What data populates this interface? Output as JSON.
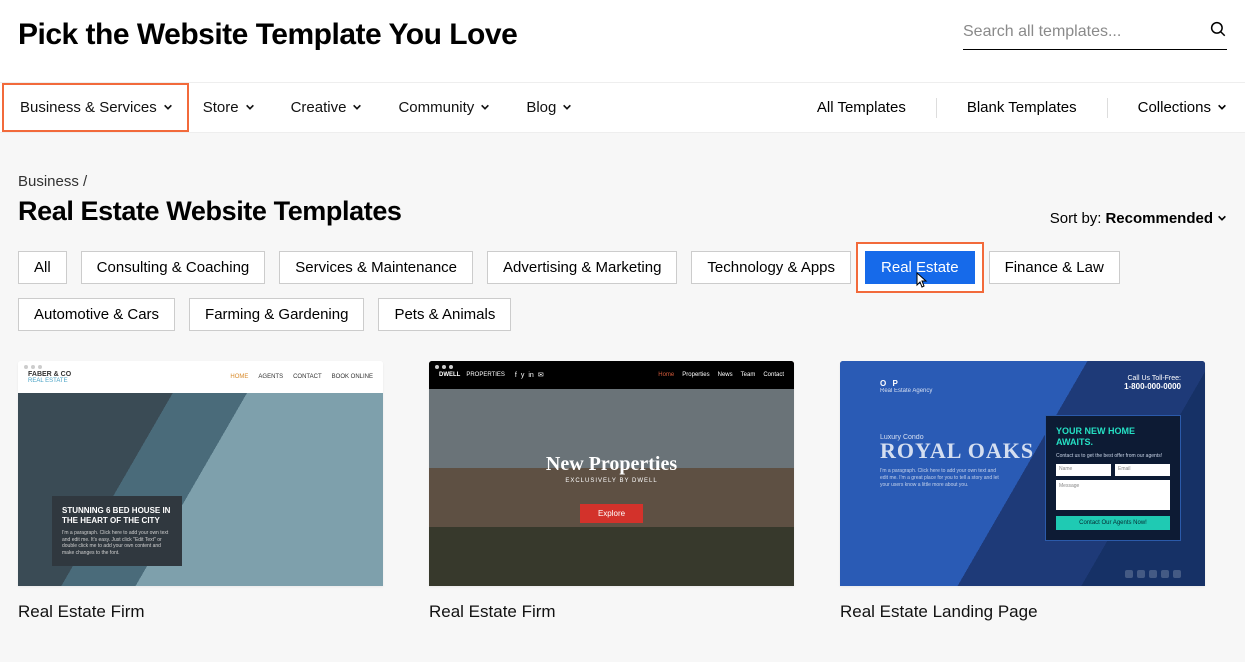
{
  "header": {
    "title": "Pick the Website Template You Love",
    "search_placeholder": "Search all templates..."
  },
  "nav_left": [
    {
      "label": "Business & Services",
      "has_chevron": true,
      "highlighted": true
    },
    {
      "label": "Store",
      "has_chevron": true
    },
    {
      "label": "Creative",
      "has_chevron": true
    },
    {
      "label": "Community",
      "has_chevron": true
    },
    {
      "label": "Blog",
      "has_chevron": true
    }
  ],
  "nav_right": [
    {
      "label": "All Templates",
      "has_chevron": false
    },
    {
      "label": "Blank Templates",
      "has_chevron": false
    },
    {
      "label": "Collections",
      "has_chevron": true
    }
  ],
  "breadcrumb": "Business /",
  "subtitle": "Real Estate Website Templates",
  "sort": {
    "label": "Sort by:",
    "value": "Recommended"
  },
  "filters": [
    "All",
    "Consulting & Coaching",
    "Services & Maintenance",
    "Advertising & Marketing",
    "Technology & Apps",
    "Real Estate",
    "Finance & Law",
    "Automotive & Cars",
    "Farming & Gardening",
    "Pets & Animals"
  ],
  "filters_selected": "Real Estate",
  "filters_highlighted": "Real Estate",
  "cards": [
    {
      "title": "Real Estate Firm"
    },
    {
      "title": "Real Estate Firm"
    },
    {
      "title": "Real Estate Landing Page"
    }
  ],
  "thumb1": {
    "brand_top": "FABER & CO",
    "brand_bottom": "REAL ESTATE",
    "menu": [
      "HOME",
      "AGENTS",
      "CONTACT",
      "BOOK ONLINE"
    ],
    "overlay_heading": "STUNNING 6 BED HOUSE IN THE HEART OF THE CITY",
    "overlay_para": "I'm a paragraph. Click here to add your own text and edit me. It's easy. Just click \"Edit Text\" or double click me to add your own content and make changes to the font."
  },
  "thumb2": {
    "brand": "DWELL",
    "brand_suffix": "PROPERTIES",
    "menu": [
      "Home",
      "Properties",
      "News",
      "Team",
      "Contact"
    ],
    "hero_title": "New Properties",
    "hero_sub": "EXCLUSIVELY BY DWELL",
    "button": "Explore"
  },
  "thumb3": {
    "logo": "O P",
    "logo_sub": "Real Estate Agency",
    "tollfree_label": "Call Us Toll-Free:",
    "tollfree_number": "1-800-000-0000",
    "tag": "Luxury Condo",
    "hero_title": "ROYAL OAKS",
    "para": "I'm a paragraph. Click here to add your own text and edit me. I'm a great place for you to tell a story and let your users know a little more about you.",
    "form_heading": "YOUR NEW HOME AWAITS.",
    "form_sub": "Contact us to get the best offer from our agents!",
    "field_name": "Name",
    "field_email": "Email",
    "field_msg": "Message",
    "form_button": "Contact Our Agents Now!"
  }
}
